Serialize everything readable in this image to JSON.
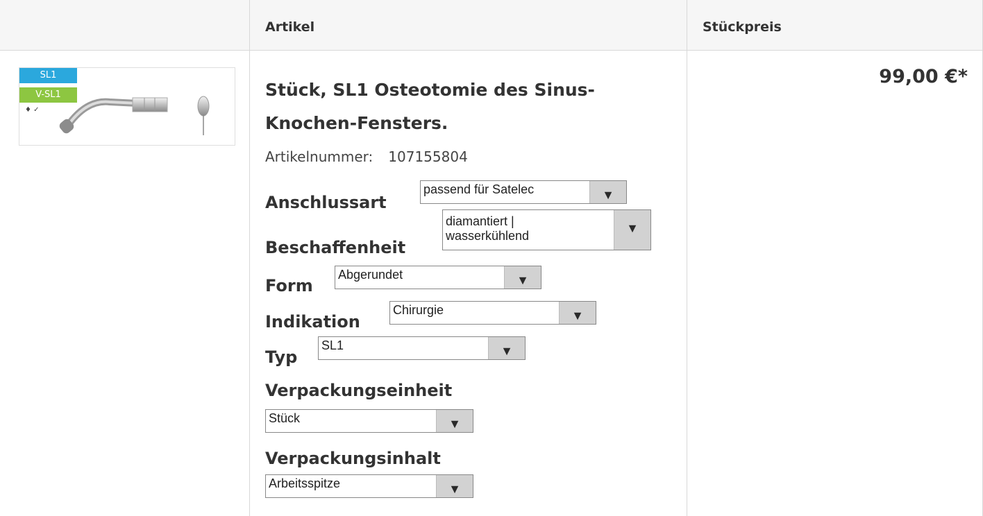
{
  "header": {
    "col_article": "Artikel",
    "col_unit_price": "Stückpreis"
  },
  "product": {
    "thumbnail": {
      "badge_1": "SL1",
      "badge_2": "V-SL1",
      "icons_text": "♦ ✓"
    },
    "title_line1": "Stück, SL1 Osteotomie des Sinus-",
    "title_line2": "Knochen-Fensters.",
    "article_number_label": "Artikelnummer:",
    "article_number": "107155804",
    "price": "99,00 €*"
  },
  "options": [
    {
      "label": "Anschlussart",
      "value": "passend für Satelec"
    },
    {
      "label": "Beschaffenheit",
      "value_line1": "diamantiert |",
      "value_line2": "wasserkühlend"
    },
    {
      "label": "Form",
      "value": "Abgerundet"
    },
    {
      "label": "Indikation",
      "value": "Chirurgie"
    },
    {
      "label": "Typ",
      "value": "SL1"
    },
    {
      "label": "Verpackungseinheit",
      "value": "Stück"
    },
    {
      "label": "Verpackungsinhalt",
      "value": "Arbeitsspitze"
    }
  ],
  "dropdown_arrow": "▼"
}
